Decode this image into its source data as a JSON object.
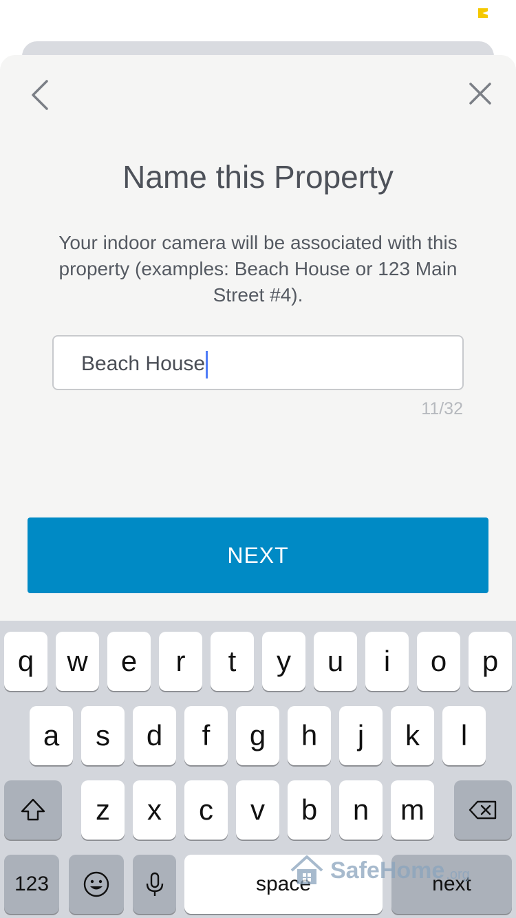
{
  "screen": {
    "title": "Name this Property",
    "description": "Your indoor camera will be associated with this property (examples: Beach House or 123 Main Street #4).",
    "input_value": "Beach House",
    "char_counter": "11/32",
    "next_label": "NEXT"
  },
  "icons": {
    "back": "chevron-left-icon",
    "close": "close-icon",
    "shift": "shift-icon",
    "delete": "backspace-icon",
    "emoji": "emoji-icon",
    "mic": "microphone-icon"
  },
  "colors": {
    "primary": "#008ac5",
    "caret": "#4f7cf7",
    "status_indicator": "#f5c800"
  },
  "keyboard": {
    "row1": [
      "q",
      "w",
      "e",
      "r",
      "t",
      "y",
      "u",
      "i",
      "o",
      "p"
    ],
    "row2": [
      "a",
      "s",
      "d",
      "f",
      "g",
      "h",
      "j",
      "k",
      "l"
    ],
    "row3": [
      "z",
      "x",
      "c",
      "v",
      "b",
      "n",
      "m"
    ],
    "numbers_label": "123",
    "space_label": "space",
    "return_label": "next"
  },
  "watermark": {
    "name": "SafeHome",
    "suffix": ".org"
  }
}
